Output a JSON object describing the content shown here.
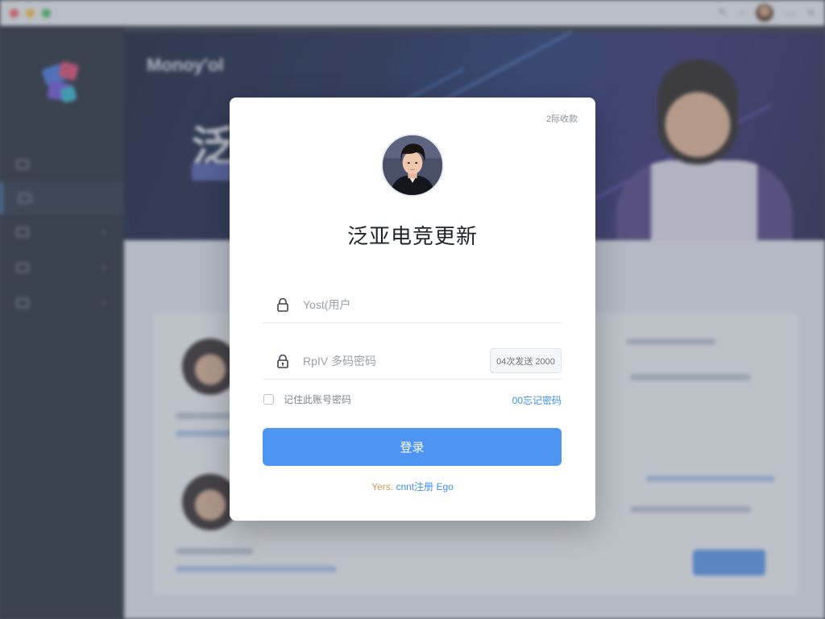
{
  "window": {
    "title": ""
  },
  "background": {
    "banner_title": "Monoy'ol",
    "banner_heading": "泛",
    "section_title": ""
  },
  "login": {
    "corner_link": "2际收款",
    "title": "泛亚电竞更新",
    "username_placeholder": "Yost(用户",
    "password_placeholder": "RpIV 多码密码",
    "get_code_button": "04次发送 2000",
    "remember_label": "记住此账号密码",
    "forgot_link": "00忘记密码",
    "submit_label": "登录",
    "footer_prefix": "Yers. ",
    "footer_link": "cnnt注册 Ego"
  },
  "colors": {
    "primary": "#4e95f2",
    "link": "#3f8ef0",
    "footer_accent": "#c89b5a",
    "sidebar_bg": "#1c2230"
  },
  "icons": {
    "username": "lock-icon",
    "password": "lock-keyhole-icon"
  }
}
